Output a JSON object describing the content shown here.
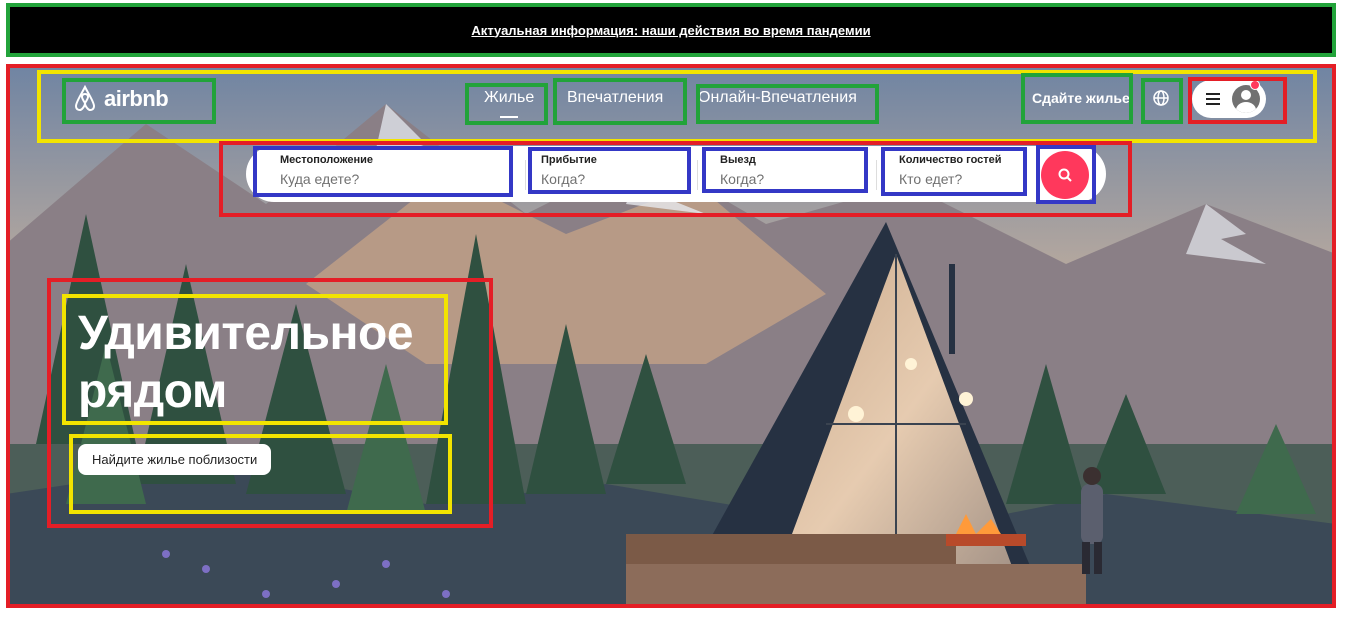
{
  "banner": {
    "text": "Актуальная информация: наши действия во время пандемии"
  },
  "header": {
    "logo_text": "airbnb",
    "tabs": [
      {
        "label": "Жилье",
        "active": true
      },
      {
        "label": "Впечатления",
        "active": false
      },
      {
        "label": "Онлайн-Впечатления",
        "active": false
      }
    ],
    "host_link": "Сдайте жилье",
    "icons": [
      "globe-icon",
      "menu-icon",
      "avatar-icon"
    ]
  },
  "search": {
    "fields": [
      {
        "label": "Местоположение",
        "placeholder": "Куда едете?"
      },
      {
        "label": "Прибытие",
        "placeholder": "Когда?"
      },
      {
        "label": "Выезд",
        "placeholder": "Когда?"
      },
      {
        "label": "Количество гостей",
        "placeholder": "Кто едет?"
      }
    ],
    "button_icon": "search-icon"
  },
  "hero": {
    "title": "Удивительное рядом",
    "cta": "Найдите жилье поблизости"
  },
  "colors": {
    "brand": "#ff385c",
    "banner_bg": "#000000"
  }
}
